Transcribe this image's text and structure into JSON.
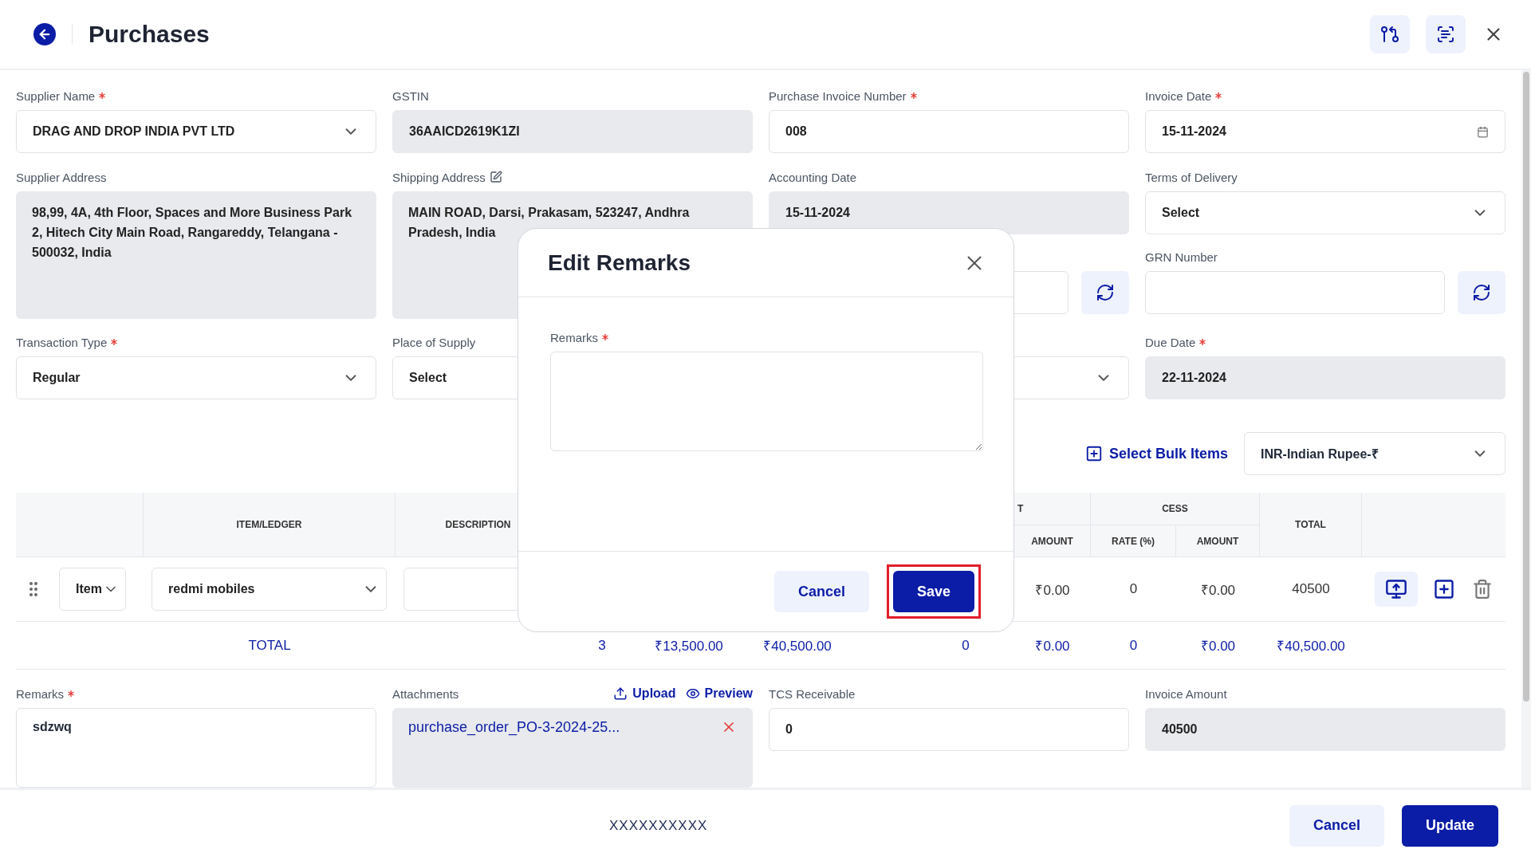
{
  "header": {
    "title": "Purchases"
  },
  "row1": [
    {
      "kind": "select",
      "label": "Supplier Name",
      "required": true,
      "value": "DRAG AND DROP INDIA PVT LTD"
    },
    {
      "kind": "readonly",
      "label": "GSTIN",
      "value": "36AAICD2619K1ZI"
    },
    {
      "kind": "input",
      "label": "Purchase Invoice Number",
      "required": true,
      "value": "008"
    },
    {
      "kind": "date",
      "label": "Invoice Date",
      "required": true,
      "value": "15-11-2024"
    }
  ],
  "row2": [
    [
      {
        "kind": "area",
        "label": "Supplier Address",
        "value": "98,99, 4A, 4th Floor, Spaces and More Business Park 2, Hitech City Main Road, Rangareddy, Telangana - 500032, India"
      }
    ],
    [
      {
        "kind": "area",
        "label": "Shipping Address",
        "edit_icon": true,
        "value": "MAIN ROAD, Darsi, Prakasam, 523247, Andhra Pradesh, India"
      }
    ],
    [
      {
        "kind": "readonly",
        "label": "Accounting Date",
        "value": "15-11-2024"
      },
      {
        "kind": "refresh"
      }
    ],
    [
      {
        "kind": "select",
        "label": "Terms of Delivery",
        "value": "Select"
      },
      {
        "kind": "refresh",
        "label": "GRN Number"
      }
    ]
  ],
  "row3": [
    {
      "kind": "select",
      "label": "Transaction Type",
      "required": true,
      "value": "Regular"
    },
    {
      "kind": "input",
      "label": "Place of Supply",
      "value": "Select"
    },
    {
      "kind": "select"
    },
    {
      "kind": "readonly",
      "label": "Due Date",
      "required": true,
      "value": "22-11-2024"
    }
  ],
  "bulk": {
    "link": "Select Bulk Items",
    "currency": "INR-Indian Rupee-₹"
  },
  "table": {
    "item_header": "ITEM/LEDGER",
    "description_header": "DESCRIPTION",
    "tax_group": "T",
    "tax_amount": "AMOUNT",
    "cess_group": "CESS",
    "cess_rate": "RATE (%)",
    "cess_amount": "AMOUNT",
    "total_header": "TOTAL",
    "row": {
      "type": "Item",
      "item": "redmi mobiles",
      "values": [
        "₹0.00",
        "0",
        "₹0.00",
        "40500"
      ]
    },
    "totals": {
      "label": "TOTAL",
      "values": [
        "3",
        "₹13,500.00",
        "₹40,500.00",
        "0",
        "₹0.00",
        "0",
        "₹0.00",
        "₹40,500.00"
      ]
    }
  },
  "remarks": {
    "label": "Remarks",
    "required": true,
    "value": "sdzwq"
  },
  "attachments": {
    "label": "Attachments",
    "upload": "Upload",
    "preview": "Preview",
    "file": "purchase_order_PO-3-2024-25..."
  },
  "tcs": {
    "label": "TCS Receivable",
    "value": "0"
  },
  "invoice_amount": {
    "label": "Invoice Amount",
    "value": "40500"
  },
  "footer": {
    "note": "XXXXXXXXXX",
    "cancel": "Cancel",
    "update": "Update"
  },
  "modal": {
    "title": "Edit Remarks",
    "field_label": "Remarks",
    "required": true,
    "cancel": "Cancel",
    "save": "Save",
    "save_highlighted": true
  }
}
